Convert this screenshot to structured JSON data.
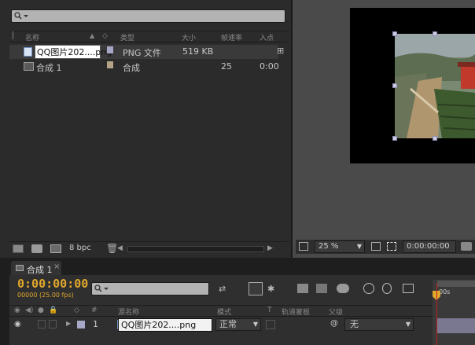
{
  "project": {
    "search_placeholder": "",
    "columns": {
      "name": "名称",
      "type": "类型",
      "size": "大小",
      "framerate": "帧速率",
      "in": "入点"
    },
    "items": [
      {
        "name": "QQ图片202....png",
        "type": "PNG 文件",
        "size": "519 KB",
        "framerate": "",
        "in": "",
        "swatch": "#a7a7c7",
        "selected": true
      },
      {
        "name": "合成 1",
        "type": "合成",
        "size": "",
        "framerate": "25",
        "in": "0:00",
        "swatch": "#b4a386",
        "selected": false
      }
    ],
    "bit_depth": "8 bpc"
  },
  "viewer": {
    "zoom": "25 %",
    "timecode": "0:00:00:00"
  },
  "timeline": {
    "tab_label": "合成 1",
    "timecode": "0:00:00:00",
    "fps_line": "00000 (25.00 fps)",
    "ruler_label": "00s",
    "columns": {
      "hash": "#",
      "source_name": "源名称",
      "mode": "模式",
      "t": "T",
      "trkmat": "轨道蒙板",
      "parent": "父级"
    },
    "layer": {
      "index": "1",
      "name": "QQ图片202....png",
      "mode": "正常",
      "parent": "无",
      "swatch": "#a7a7c7"
    }
  },
  "colors": {
    "accent_timecode": "#e1a72d",
    "selection": "#3a3a3a",
    "playhead": "#c02020"
  }
}
